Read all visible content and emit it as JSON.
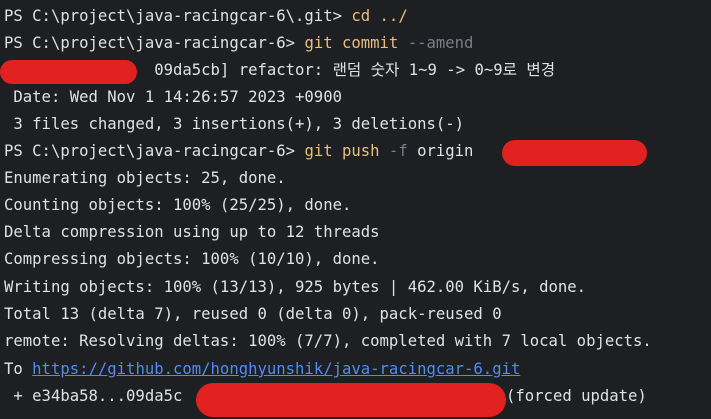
{
  "terminal": {
    "lines": [
      {
        "prompt": "PS C:\\project\\java-racingcar-6\\.git> ",
        "cmd": "cd ../"
      },
      {
        "prompt": "PS C:\\project\\java-racingcar-6> ",
        "cmd": "git commit",
        "flag": " --amend"
      },
      {
        "text": "                09da5cb] refactor: 랜덤 숫자 1~9 -> 0~9로 변경"
      },
      {
        "text": " Date: Wed Nov 1 14:26:57 2023 +0900"
      },
      {
        "text": " 3 files changed, 3 insertions(+), 3 deletions(-)"
      },
      {
        "prompt": "PS C:\\project\\java-racingcar-6> ",
        "cmd": "git push",
        "flag": " -f ",
        "rest": "origin"
      },
      {
        "text": "Enumerating objects: 25, done."
      },
      {
        "text": "Counting objects: 100% (25/25), done."
      },
      {
        "text": "Delta compression using up to 12 threads"
      },
      {
        "text": "Compressing objects: 100% (10/10), done."
      },
      {
        "text": "Writing objects: 100% (13/13), 925 bytes | 462.00 KiB/s, done."
      },
      {
        "text": "Total 13 (delta 7), reused 0 (delta 0), pack-reused 0"
      },
      {
        "text": "remote: Resolving deltas: 100% (7/7), completed with 7 local objects."
      },
      {
        "prefix": "To ",
        "link": "https://github.com/honghyunshik/java-racingcar-6.git"
      },
      {
        "left": " + e34ba58...09da5c",
        "right": "(forced update)"
      }
    ]
  },
  "colors": {
    "background": "#1e1f22",
    "text": "#dfe1e5",
    "command": "#e5c07b",
    "flag": "#7a7e85",
    "link": "#548af7",
    "redaction": "#e0211f"
  }
}
